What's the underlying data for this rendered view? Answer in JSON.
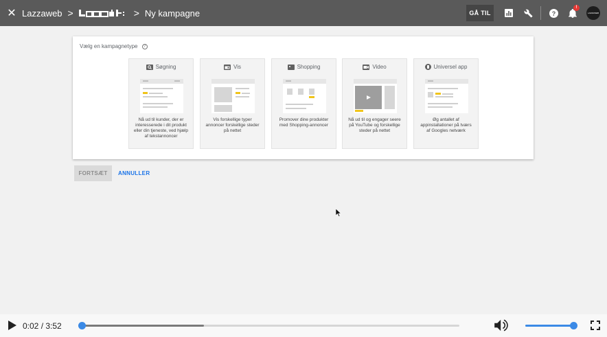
{
  "topbar": {
    "close_glyph": "✕",
    "account": "Lazzaweb",
    "chevron": ">",
    "page_title": "Ny kampagne",
    "goto_label": "GÅ TIL",
    "notification_count": "!",
    "avatar_text": "LAZZAWEB"
  },
  "panel": {
    "title": "Vælg en kampagnetype",
    "help_glyph": "?",
    "cards": [
      {
        "label": "Søgning",
        "icon": "search-icon",
        "desc": "Nå ud til kunder, der er interesserede i dit produkt eller din tjeneste, ved hjælp af tekstannoncer"
      },
      {
        "label": "Vis",
        "icon": "display-icon",
        "desc": "Vis forskellige typer annoncer forskellige steder på nettet"
      },
      {
        "label": "Shopping",
        "icon": "tag-icon",
        "desc": "Promover dine produkter med Shopping-annoncer"
      },
      {
        "label": "Video",
        "icon": "video-icon",
        "desc": "Nå ud til og engager seere på YouTube og forskellige steder på nettet"
      },
      {
        "label": "Universel app",
        "icon": "app-icon",
        "desc": "Øg antallet af appinstallationer på tværs af Googles netværk"
      }
    ]
  },
  "actions": {
    "continue_label": "FORTSÆT",
    "cancel_label": "ANNULLER"
  },
  "player": {
    "time": "0:02 / 3:52",
    "progress": 0.009,
    "buffered": 0.33,
    "volume": 1.0
  },
  "colors": {
    "topbar": "#5a5a5a",
    "accent": "#1a73e8",
    "slider": "#3b8ae6",
    "highlight": "#f0c419"
  }
}
